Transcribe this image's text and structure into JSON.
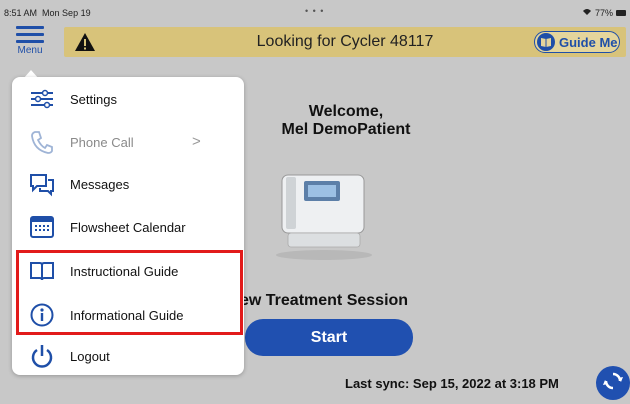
{
  "status_bar": {
    "time": "8:51 AM",
    "date": "Mon Sep 19",
    "battery": "77%",
    "dots": "• • •"
  },
  "menu_button": {
    "label": "Menu"
  },
  "header": {
    "title": "Looking for Cycler 48117",
    "guide_button": "Guide Me",
    "banner_color": "#d8c37a"
  },
  "main": {
    "welcome_line1": "Welcome,",
    "welcome_line2": "Mel DemoPatient",
    "session_title": "ew Treatment Session",
    "start_label": "Start",
    "last_sync": "Last sync: Sep 15, 2022 at 3:18 PM"
  },
  "menu": {
    "items": [
      {
        "label": "Settings",
        "icon": "sliders-icon"
      },
      {
        "label": "Phone Call",
        "icon": "phone-icon",
        "disabled": true
      },
      {
        "label": "Messages",
        "icon": "chat-icon"
      },
      {
        "label": "Flowsheet Calendar",
        "icon": "calendar-icon"
      },
      {
        "label": "Instructional Guide",
        "icon": "book-icon"
      },
      {
        "label": "Informational Guide",
        "icon": "info-icon"
      },
      {
        "label": "Logout",
        "icon": "power-icon"
      }
    ],
    "chevron": ">"
  },
  "colors": {
    "accent": "#1f4fa8",
    "button": "#2050b0",
    "highlight": "#e21b1b",
    "background": "#c8c8c8"
  }
}
